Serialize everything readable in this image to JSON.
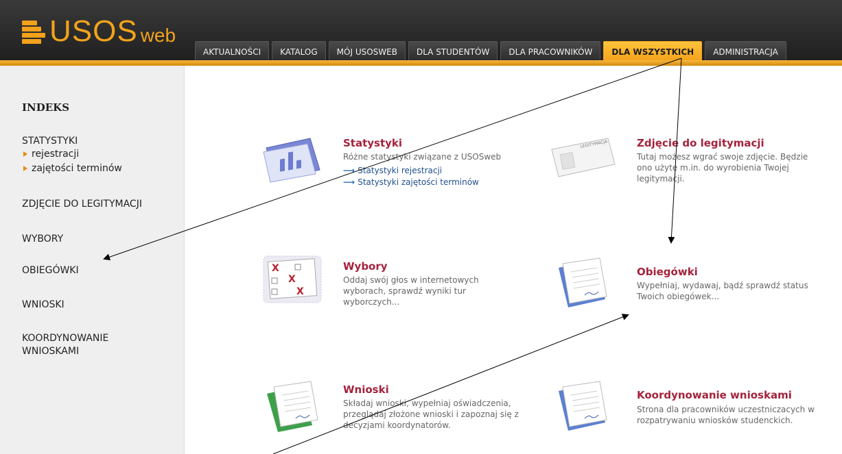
{
  "logo": {
    "usos": "USOS",
    "web": "web"
  },
  "tabs": [
    {
      "label": "AKTUALNOŚCI"
    },
    {
      "label": "KATALOG"
    },
    {
      "label": "MÓJ USOSWEB"
    },
    {
      "label": "DLA STUDENTÓW"
    },
    {
      "label": "DLA PRACOWNIKÓW"
    },
    {
      "label": "DLA WSZYSTKICH",
      "active": true
    },
    {
      "label": "ADMINISTRACJA"
    }
  ],
  "sidebar": {
    "heading": "INDEKS",
    "statystyki": "STATYSTYKI",
    "sub1": "rejestracji",
    "sub2": "zajętości terminów",
    "zdjecie": "ZDJĘCIE DO LEGITYMACJI",
    "wybory": "WYBORY",
    "obiegowki": "OBIEGÓWKI",
    "wnioski": "WNIOSKI",
    "koordynowanie1": "KOORDYNOWANIE",
    "koordynowanie2": "WNIOSKAMI"
  },
  "tiles": {
    "statystyki": {
      "title": "Statystyki",
      "desc": "Różne statystyki związane z USOSweb",
      "link1": "Statystyki rejestracji",
      "link2": "Statystyki zajętości terminów"
    },
    "zdjecie": {
      "title": "Zdjęcie do legitymacji",
      "desc": "Tutaj możesz wgrać swoje zdjęcie. Będzie ono użyte m.in. do wyrobienia Twojej legitymacji.",
      "card_label": "LEGITYMACJA"
    },
    "wybory": {
      "title": "Wybory",
      "desc": "Oddaj swój głos w internetowych wyborach, sprawdź wyniki tur wyborczych..."
    },
    "obiegowki": {
      "title": "Obiegówki",
      "desc": "Wypełniaj, wydawaj, bądź sprawdź status Twoich obiegówek..."
    },
    "wnioski": {
      "title": "Wnioski",
      "desc": "Składaj wnioski, wypełniaj oświadczenia, przeglądaj złożone wnioski i zapoznaj się z decyzjami koordynatorów."
    },
    "koordynowanie": {
      "title": "Koordynowanie wnioskami",
      "desc": "Strona dla pracowników uczestniczacych w rozpatrywaniu wniosków studenckich."
    }
  },
  "colors": {
    "accent": "#f3a21b",
    "title": "#a4223c",
    "link": "#1f4f90"
  }
}
